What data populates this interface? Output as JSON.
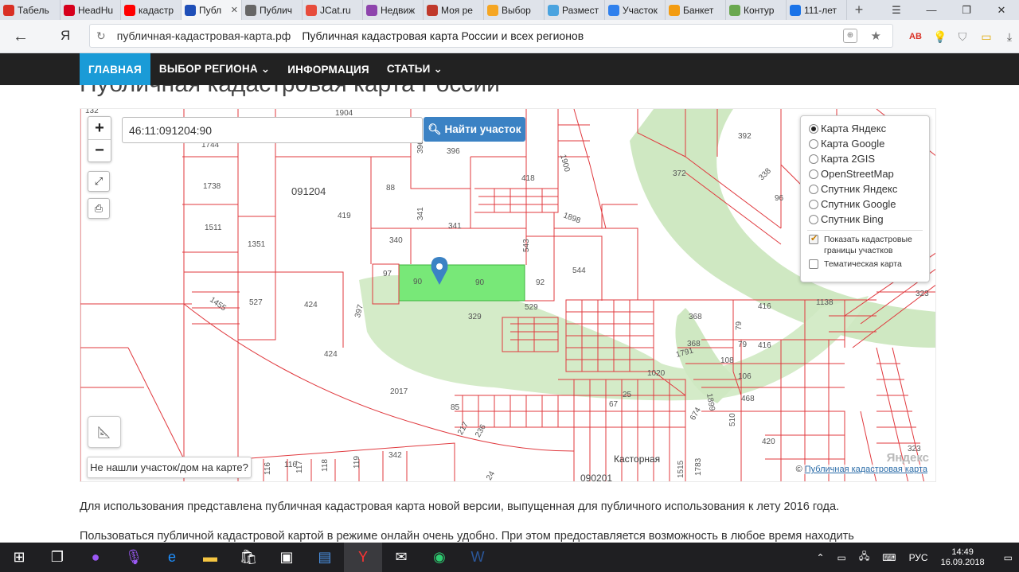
{
  "browser": {
    "tabs": [
      {
        "label": "Табель",
        "favicon": "M",
        "color": "#d93025"
      },
      {
        "label": "HeadHu",
        "favicon": "hh",
        "color": "#d6001c"
      },
      {
        "label": "кадастр",
        "favicon": "Я",
        "color": "#ff0000"
      },
      {
        "label": "Публ",
        "favicon": "flag",
        "color": "#1f4fb8",
        "active": true
      },
      {
        "label": "Публич",
        "favicon": "doc",
        "color": "#666666"
      },
      {
        "label": "JCat.ru",
        "favicon": "J",
        "color": "#e74c3c"
      },
      {
        "label": "Недвиж",
        "favicon": "N",
        "color": "#8e44ad"
      },
      {
        "label": "Моя ре",
        "favicon": "M",
        "color": "#c0392b"
      },
      {
        "label": "Выбор",
        "favicon": "●",
        "color": "#f5a623"
      },
      {
        "label": "Размест",
        "favicon": "pin",
        "color": "#4aa3df"
      },
      {
        "label": "Участок",
        "favicon": "✽",
        "color": "#2f80ed"
      },
      {
        "label": "Банкет",
        "favicon": "‖",
        "color": "#f39c12"
      },
      {
        "label": "Контур",
        "favicon": "◇",
        "color": "#6aa84f"
      },
      {
        "label": "111-лет",
        "favicon": "111",
        "color": "#1a73e8"
      }
    ],
    "address": {
      "domain": "публичная-кадастровая-карта.рф",
      "page_title": "Публичная кадастровая карта России и всех регионов"
    }
  },
  "site": {
    "nav": [
      {
        "label": "ГЛАВНАЯ",
        "active": true
      },
      {
        "label": "ВЫБОР РЕГИОНА ⌄"
      },
      {
        "label": "ИНФОРМАЦИЯ"
      },
      {
        "label": "СТАТЬИ ⌄"
      }
    ],
    "heading": "Публичная кадастровая карта России"
  },
  "map": {
    "search_value": "46:11:091204:90",
    "search_button": "Найти участок",
    "layers": [
      {
        "label": "Карта Яндекс",
        "selected": true
      },
      {
        "label": "Карта Google"
      },
      {
        "label": "Карта 2GIS"
      },
      {
        "label": "OpenStreetMap"
      },
      {
        "label": "Спутник Яндекс"
      },
      {
        "label": "Спутник Google"
      },
      {
        "label": "Спутник Bing"
      }
    ],
    "options": [
      {
        "label": "Показать кадастровые границы участков",
        "checked": true
      },
      {
        "label": "Тематическая карта",
        "checked": false
      }
    ],
    "not_found_button": "Не нашли участок/дом на карте?",
    "copyright_prefix": "© ",
    "copyright_link": "Публичная кадастровая карта",
    "yandex": "Яндекс",
    "labels": {
      "l132": "132",
      "l1904": "1904",
      "l1744": "1744",
      "l396a": "396",
      "l396b": "396",
      "l1900": "1900",
      "l418": "418",
      "l392": "392",
      "l372": "372",
      "l338": "338",
      "l96": "96",
      "l1738": "1738",
      "lblock": "091204",
      "l88": "88",
      "l419": "419",
      "l341a": "341",
      "l341b": "341",
      "l1898": "1898",
      "l1511": "1511",
      "l1351": "1351",
      "l340": "340",
      "l543": "543",
      "l544": "544",
      "l97": "97",
      "l90a": "90",
      "l90b": "90",
      "l92": "92",
      "l527": "527",
      "l424a": "424",
      "l1455": "1455",
      "l397": "397",
      "l329": "329",
      "l529": "529",
      "l416a": "416",
      "l1138": "1138",
      "l323a": "323",
      "l368a": "368",
      "l79a": "79",
      "l368b": "368",
      "l79b": "79",
      "l416b": "416",
      "l1791": "1791",
      "l108": "108",
      "l106": "106",
      "l424b": "424",
      "l1020": "1020",
      "l2017": "2017",
      "l25": "25",
      "l67": "67",
      "l468": "468",
      "l85": "85",
      "l674": "674",
      "l1899": "1899",
      "l510": "510",
      "l217": "217",
      "l236": "236",
      "l420": "420",
      "l323b": "323",
      "l116a": "116",
      "l116b": "116",
      "l117": "117",
      "l118": "118",
      "l119": "119",
      "l342": "342",
      "l24": "24",
      "l1783": "1783",
      "l1515": "1515",
      "ltown": "Касторная",
      "lblock2": "090201"
    }
  },
  "content": {
    "p1": "Для использования представлена публичная кадастровая карта новой версии, выпущенная для публичного использования к лету 2016 года.",
    "p2": "Пользоваться публичной кадастровой картой в режиме онлайн очень удобно. При этом предоставляется возможность в любое время находить"
  },
  "taskbar": {
    "lang": "РУС",
    "time": "14:49",
    "date": "16.09.2018"
  }
}
